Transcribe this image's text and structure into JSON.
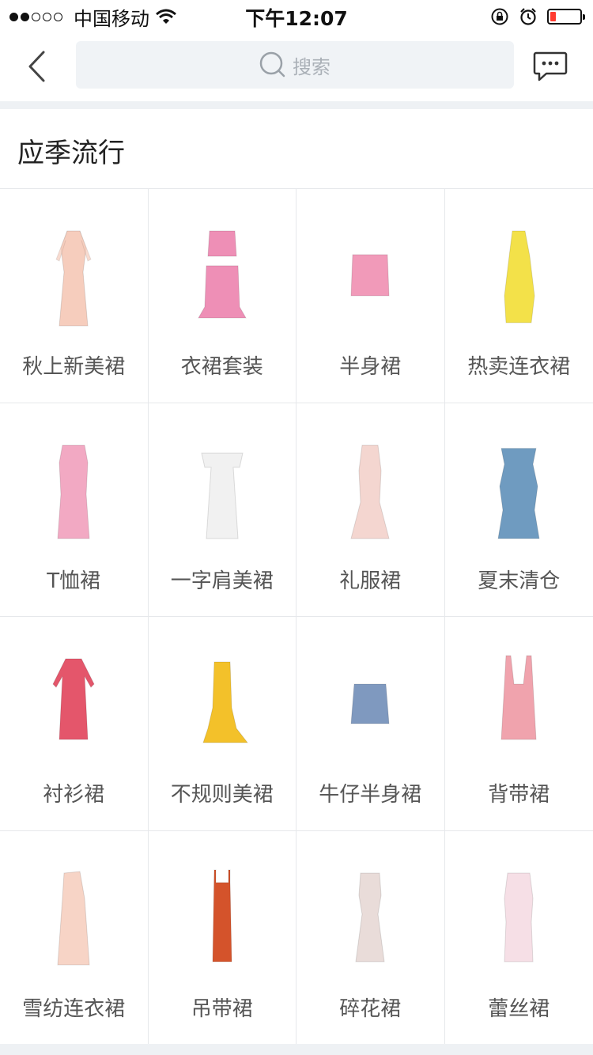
{
  "status_bar": {
    "carrier": "中国移动",
    "time": "下午12:07",
    "signal_icon": "signal-dots-icon",
    "wifi_icon": "wifi-icon",
    "battery_color": "#ff3b30"
  },
  "navbar": {
    "back_icon": "chevron-left-icon",
    "search_placeholder": "搜索",
    "message_icon": "chat-bubble-icon"
  },
  "section": {
    "title": "应季流行",
    "items": [
      {
        "label": "秋上新美裙",
        "icon": "pink-dress-icon",
        "color": "#f6cdbd"
      },
      {
        "label": "衣裙套装",
        "icon": "pink-two-piece-set-icon",
        "color": "#ee8fb6"
      },
      {
        "label": "半身裙",
        "icon": "gingham-skirt-icon",
        "color": "#f19ab9"
      },
      {
        "label": "热卖连衣裙",
        "icon": "yellow-dress-icon",
        "color": "#f3e149"
      },
      {
        "label": "T恤裙",
        "icon": "pink-check-dress-icon",
        "color": "#f2a9c3"
      },
      {
        "label": "一字肩美裙",
        "icon": "white-offshoulder-dress-icon",
        "color": "#f1f1f1"
      },
      {
        "label": "礼服裙",
        "icon": "gown-icon",
        "color": "#f4d6d0"
      },
      {
        "label": "夏末清仓",
        "icon": "floral-tiered-dress-icon",
        "color": "#6f9bc0"
      },
      {
        "label": "衬衫裙",
        "icon": "shirt-dress-icon",
        "color": "#e4566b"
      },
      {
        "label": "不规则美裙",
        "icon": "mermaid-dress-icon",
        "color": "#f3c12a"
      },
      {
        "label": "牛仔半身裙",
        "icon": "denim-skirt-icon",
        "color": "#7f99bf"
      },
      {
        "label": "背带裙",
        "icon": "pinafore-dress-icon",
        "color": "#f0a3ad"
      },
      {
        "label": "雪纺连衣裙",
        "icon": "chiffon-dress-icon",
        "color": "#f7d4c6"
      },
      {
        "label": "吊带裙",
        "icon": "slip-dress-icon",
        "color": "#d4532b"
      },
      {
        "label": "碎花裙",
        "icon": "floral-dress-icon",
        "color": "#e9dcd9"
      },
      {
        "label": "蕾丝裙",
        "icon": "lace-dress-icon",
        "color": "#f6dfe6"
      }
    ]
  }
}
